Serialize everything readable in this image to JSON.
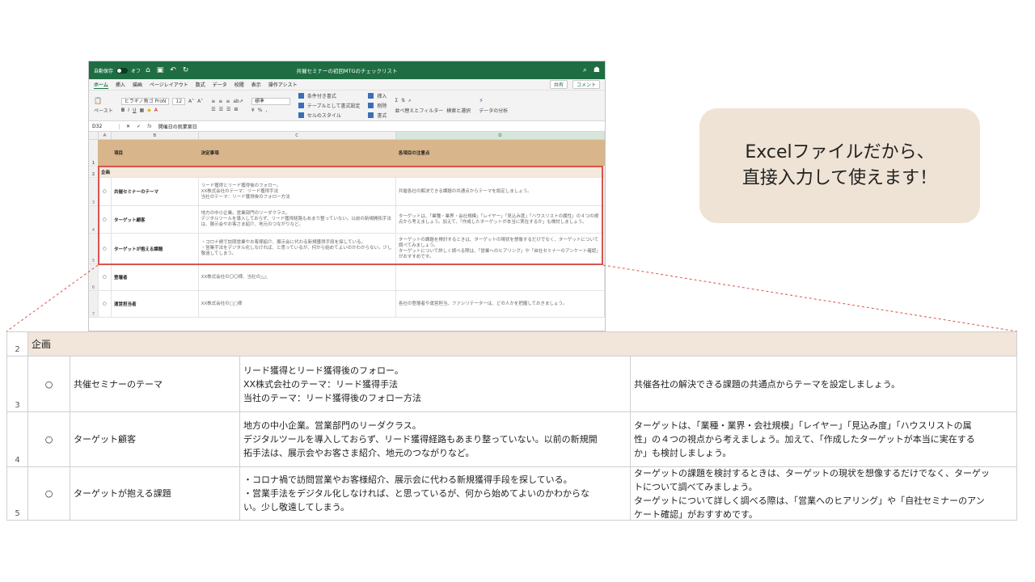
{
  "excel": {
    "autosave_label": "自動保存",
    "autosave_state": "オフ",
    "doc_title": "共催セミナーの初回MTGのチェックリスト",
    "menu": [
      "ホーム",
      "挿入",
      "描画",
      "ページレイアウト",
      "数式",
      "データ",
      "校閲",
      "表示",
      "操作アシスト"
    ],
    "share_label": "共有",
    "comment_label": "コメント",
    "ribbon": {
      "paste": "ペースト",
      "font_name": "ヒラギノ角ゴ ProN",
      "font_size": "12",
      "number_format": "標準",
      "cond_format": "条件付き書式",
      "table_format": "テーブルとして書式設定",
      "cell_style": "セルのスタイル",
      "insert": "挿入",
      "delete": "削除",
      "format": "書式",
      "sort_filter": "並べ替えとフィルター",
      "find_select": "検索と選択",
      "analyze": "データの分析"
    },
    "cell_ref": "D32",
    "formula_value": "開催日の就業案日",
    "columns": [
      "A",
      "B",
      "C",
      "D"
    ],
    "header": {
      "item": "項目",
      "decision": "決定事項",
      "notes": "各項目の注意点"
    },
    "section": "企画",
    "rows": [
      {
        "num": "3",
        "mark": "○",
        "item": "共催セミナーのテーマ",
        "decision": "リード獲得とリード獲得後のフォロー。\nXX株式会社のテーマ：リード獲得手法\n当社のテーマ：リード獲得後のフォロー方法",
        "note": "共催各社の解決できる課題の共通点からテーマを設定しましょう。"
      },
      {
        "num": "4",
        "mark": "○",
        "item": "ターゲット顧客",
        "decision": "地方の中小企業。営業部門のリーダクラス。\nデジタルツールを導入しておらず、リード獲得経路もあまり整っていない。以前の新規開拓手法は、展示会やお客さま紹介、地元のつながりなど。",
        "note": "ターゲットは、「業種・業界・会社規模」「レイヤー」「見込み度」「ハウスリストの属性」の４つの視点から考えましょう。加えて、「作成したターゲットが本当に実在するか」も検討しましょう。"
      },
      {
        "num": "5",
        "mark": "○",
        "item": "ターゲットが抱える課題",
        "decision": "・コロナ禍で訪問営業やお客様紹介、展示会に代わる新規獲得手段を探している。\n・営業手法をデジタル化しなければ、と思っているが、何から始めてよいのかわからない。少し敬遠してしまう。",
        "note": "ターゲットの課題を検討するときは、ターゲットの現状を想像するだけでなく、ターゲットについて調べてみましょう。\nターゲットについて詳しく調べる際は、「営業へのヒアリング」や「自社セミナーのアンケート確認」がおすすめです。"
      },
      {
        "num": "6",
        "mark": "○",
        "item": "登壇者",
        "decision": "XX株式会社の〇〇様、当社の△△",
        "note": ""
      },
      {
        "num": "7",
        "mark": "○",
        "item": "運営担当者",
        "decision": "XX株式会社の□□様",
        "note": "各社の登壇者や運営担当、ファシリテーターは、どの人かを把握しておきましょう。"
      }
    ]
  },
  "callout": {
    "line1": "Excelファイルだから、",
    "line2": "直接入力して使えます！"
  },
  "zoom": {
    "section_num": "2",
    "section": "企画",
    "rows": [
      {
        "num": "3",
        "mark": "○",
        "item": "共催セミナーのテーマ",
        "decision": [
          "リード獲得とリード獲得後のフォロー。",
          "XX株式会社のテーマ：リード獲得手法",
          "当社のテーマ：リード獲得後のフォロー方法"
        ],
        "note": [
          "共催各社の解決できる課題の共通点からテーマを設定しましょう。"
        ]
      },
      {
        "num": "4",
        "mark": "○",
        "item": "ターゲット顧客",
        "decision": [
          "地方の中小企業。営業部門のリーダクラス。",
          "デジタルツールを導入しておらず、リード獲得経路もあまり整っていない。以前の新規開",
          "拓手法は、展示会やお客さま紹介、地元のつながりなど。"
        ],
        "note": [
          "ターゲットは、「業種・業界・会社規模」「レイヤー」「見込み度」「ハウスリストの属",
          "性」の４つの視点から考えましょう。加えて、「作成したターゲットが本当に実在する",
          "か」も検討しましょう。"
        ]
      },
      {
        "num": "5",
        "mark": "○",
        "item": "ターゲットが抱える課題",
        "decision": [
          "・コロナ禍で訪問営業やお客様紹介、展示会に代わる新規獲得手段を探している。",
          "・営業手法をデジタル化しなければ、と思っているが、何から始めてよいのかわからな",
          "い。少し敬遠してしまう。"
        ],
        "note": [
          "ターゲットの課題を検討するときは、ターゲットの現状を想像するだけでなく、ターゲッ",
          "トについて調べてみましょう。",
          "ターゲットについて詳しく調べる際は、「営業へのヒアリング」や「自社セミナーのアン",
          "ケート確認」がおすすめです。"
        ]
      }
    ]
  },
  "colors": {
    "excel_green": "#1f6e43",
    "header_tan": "#d8b58a",
    "section_bg": "#f1e6d9",
    "callout_bg": "#efe3d5",
    "highlight_red": "#d9534f"
  }
}
